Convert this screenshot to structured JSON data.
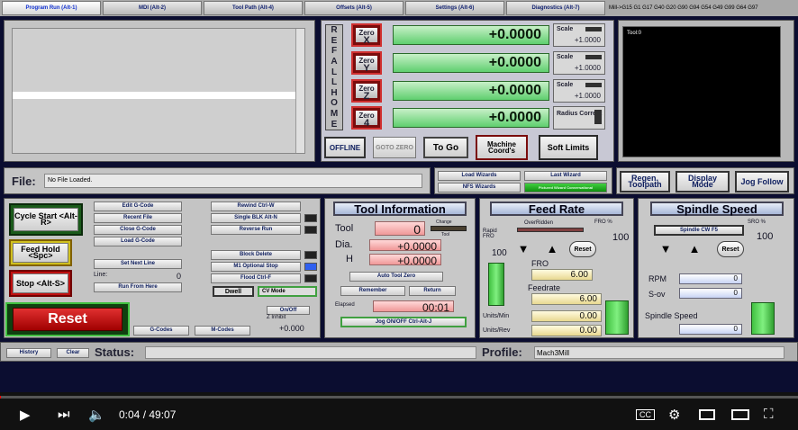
{
  "tabs": [
    {
      "label": "Program Run (Alt-1)",
      "active": true
    },
    {
      "label": "MDI (Alt-2)"
    },
    {
      "label": "Tool Path (Alt-4)"
    },
    {
      "label": "Offsets (Alt-5)"
    },
    {
      "label": "Settings (Alt-6)"
    },
    {
      "label": "Diagnostics (Alt-7)"
    }
  ],
  "gcodes_status": "Mill->G15  G1 G17 G40 G20 G90 G94 G54 G49 G99 G64 G97",
  "ref_all_home": [
    "R",
    "E",
    "F",
    "A",
    "L",
    "L",
    "H",
    "O",
    "M",
    "E"
  ],
  "axes": [
    {
      "zero_top": "Zero",
      "zero_axis": "X",
      "value": "+0.0000",
      "scale_label": "Scale",
      "scale_value": "+1.0000"
    },
    {
      "zero_top": "Zero",
      "zero_axis": "Y",
      "value": "+0.0000",
      "scale_label": "Scale",
      "scale_value": "+1.0000"
    },
    {
      "zero_top": "Zero",
      "zero_axis": "Z",
      "value": "+0.0000",
      "scale_label": "Scale",
      "scale_value": "+1.0000"
    },
    {
      "zero_top": "Zero",
      "zero_axis": "4",
      "value": "+0.0000",
      "radius_label": "Radius Correct"
    }
  ],
  "dro_buttons": {
    "offline": "OFFLINE",
    "gotoz": "GOTO ZERO",
    "togo": "To Go",
    "machine": "Machine Coord's",
    "soft": "Soft Limits"
  },
  "tool_display": "Tool:0",
  "file": {
    "label": "File:",
    "value": "No File Loaded."
  },
  "wizards": {
    "load": "Load Wizards",
    "last": "Last Wizard",
    "nfs": "NFS Wizards",
    "pictured": "Pictured Wizard Conversational"
  },
  "view_buttons": {
    "regen": "Regen. Toolpath",
    "display": "Display Mode",
    "jog": "Jog Follow"
  },
  "program": {
    "cycle_start": "Cycle Start <Alt-R>",
    "feed_hold": "Feed Hold <Spc>",
    "stop": "Stop <Alt-S>",
    "reset": "Reset",
    "edit": "Edit G-Code",
    "recent": "Recent File",
    "close": "Close G-Code",
    "load": "Load G-Code",
    "setnext": "Set Next Line",
    "line_label": "Line:",
    "line_value": "0",
    "runfrom": "Run From Here",
    "rewind": "Rewind Ctrl-W",
    "single": "Single BLK Alt-N",
    "reverse": "Reverse Run",
    "blockdel": "Block Delete",
    "m1": "M1 Optional Stop",
    "flood": "Flood Ctrl-F",
    "dwell": "Dwell",
    "cvmode": "CV Mode",
    "onoff": "On/Off",
    "zinhibit": "Z Inhibit",
    "zinhibit_value": "+0.000",
    "gcodes": "G-Codes",
    "mcodes": "M-Codes"
  },
  "tool_info": {
    "header": "Tool Information",
    "tool_label": "Tool",
    "tool_value": "0",
    "change": "Change",
    "tool_small": "Tool",
    "dia_label": "Dia.",
    "dia_value": "+0.0000",
    "h_label": "H",
    "h_value": "+0.0000",
    "auto": "Auto Tool Zero",
    "remember": "Remember",
    "return": "Return",
    "elapsed_label": "Elapsed",
    "elapsed_value": "00:01",
    "jog": "Jog ON/OFF Ctrl-Alt-J"
  },
  "feed": {
    "header": "Feed Rate",
    "overridden": "OverRidden",
    "fro_pct": "FRO %",
    "fro_pct_value": "100",
    "rapid": "Rapid FRO",
    "rapid_value": "100",
    "reset": "Reset",
    "fro_label": "FRO",
    "fro_value": "6.00",
    "feedrate_label": "Feedrate",
    "feedrate_value": "6.00",
    "upm_label": "Units/Min",
    "upm_value": "0.00",
    "upr_label": "Units/Rev",
    "upr_value": "0.00"
  },
  "spindle": {
    "header": "Spindle Speed",
    "cw": "Spindle CW F5",
    "sro_pct": "SRO %",
    "sro_value": "100",
    "reset": "Reset",
    "rpm_label": "RPM",
    "rpm_value": "0",
    "sov_label": "S-ov",
    "sov_value": "0",
    "speed_label": "Spindle Speed",
    "speed_value": "0"
  },
  "status": {
    "history": "History",
    "clear": "Clear",
    "label": "Status:",
    "profile_label": "Profile:",
    "profile_value": "Mach3Mill"
  },
  "player": {
    "time": "0:04 / 49:07",
    "progress": 0.0014
  },
  "colors": {
    "background": "#0b0d30",
    "dro_green": "#5fcf6f",
    "red_reset": "#c01010"
  }
}
